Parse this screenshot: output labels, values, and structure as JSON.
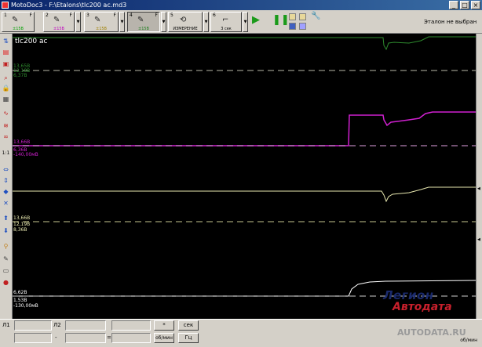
{
  "window": {
    "title": "MotoDoc3 - F:\\Etalons\\tlc200 ac.md3"
  },
  "toolbar": {
    "channels": [
      {
        "num": "1",
        "letter": "F",
        "range": "±15В",
        "color": "#00a000"
      },
      {
        "num": "2",
        "letter": "F",
        "range": "±15В",
        "color": "#c000c0"
      },
      {
        "num": "3",
        "letter": "F",
        "range": "±15В",
        "color": "#a08000"
      },
      {
        "num": "4",
        "letter": "F",
        "range": "±15В",
        "color": "#208020"
      },
      {
        "num": "5",
        "letter": "",
        "range": "ИЗМЕРЕНИЕ",
        "color": "#404040"
      },
      {
        "num": "6",
        "letter": "",
        "range": "3 сек",
        "color": "#404040"
      }
    ],
    "status": "Эталон не выбран"
  },
  "scope": {
    "title": "tlc200 ac",
    "ch1_labels": [
      "13,65В",
      "12,18В",
      "6,37В"
    ],
    "ch2_labels": [
      "13,66В",
      "6,36В",
      "-140,00мВ"
    ],
    "ch3_labels": [
      "13,66В",
      "12,19В",
      "8,36В"
    ],
    "ch4_labels": [
      "6,62В",
      "1,53В",
      "-130,00мВ"
    ]
  },
  "bottom": {
    "l1_label": "Л1",
    "l2_label": "Л2",
    "dash": "-",
    "equals": "=",
    "star_btn": "*",
    "sec_btn": "сек",
    "rpm_btn": "об/мин",
    "hz_btn": "Гц",
    "rpm_unit": "об/мин"
  },
  "watermark": {
    "line1": "Легион",
    "line2": "Автодата",
    "line3": "AUTODATA.RU"
  },
  "colors": {
    "ch1": "#2e8b2e",
    "ch2": "#c000c0",
    "ch3": "#e8e8b0",
    "ch4": "#ffffff"
  }
}
